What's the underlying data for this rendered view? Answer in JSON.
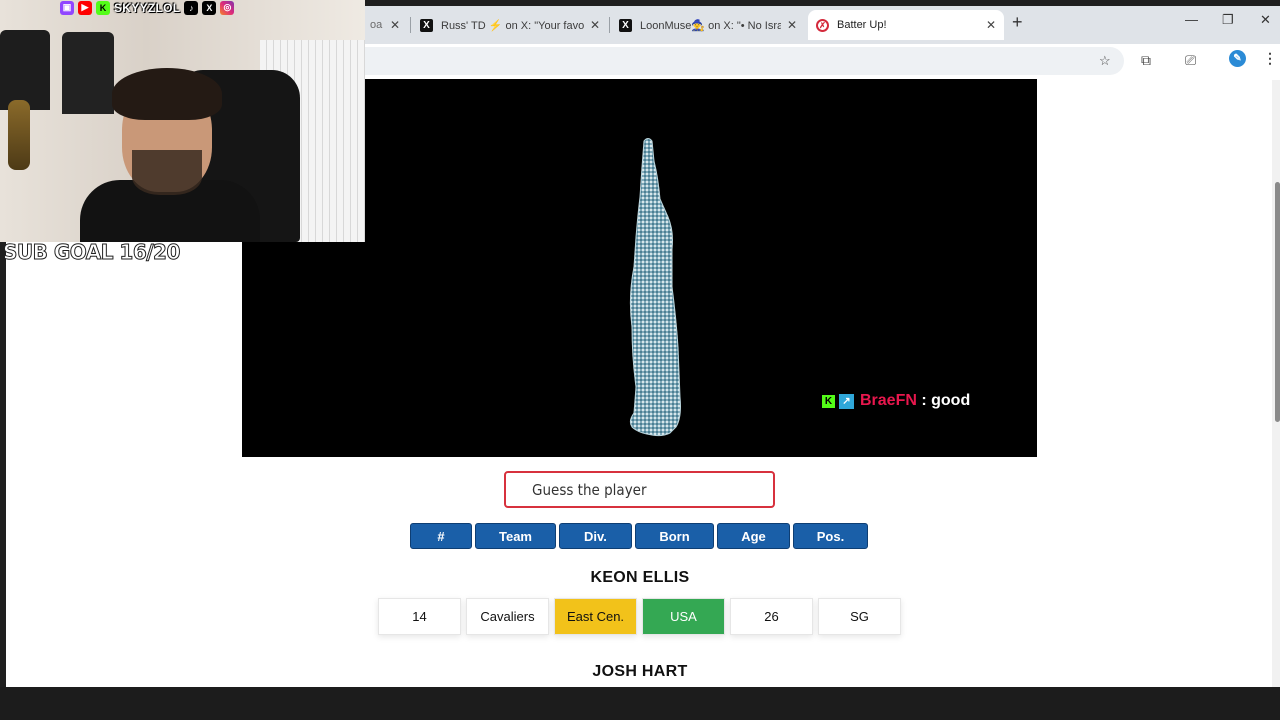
{
  "browser": {
    "tabs": [
      {
        "title": "oa",
        "favicon": "x-icon",
        "close": "✕"
      },
      {
        "title": "Russ' TD ⚡ on X: \"Your favorite",
        "favicon": "x-icon",
        "close": "✕"
      },
      {
        "title": "LoonMuse🧙 on X: \"• No Israel",
        "favicon": "x-icon",
        "close": "✕"
      },
      {
        "title": "Batter Up!",
        "favicon": "batter-up-icon",
        "close": "✕",
        "active": true
      }
    ],
    "new_tab": "+",
    "window_controls": {
      "minimize": "—",
      "restore": "❐",
      "close": "✕"
    },
    "toolbar": {
      "star": "☆",
      "extensions": "⧉",
      "cast": "⎚",
      "menu": "⋮"
    }
  },
  "stream_overlay": {
    "social_handle": "SKYYZLOL",
    "sub_goal": "SUB GOAL 16/20",
    "chat": {
      "user": "BraeFN",
      "separator": " : ",
      "message": "good"
    }
  },
  "game": {
    "guess_placeholder": "Guess the player",
    "columns": [
      "#",
      "Team",
      "Div.",
      "Born",
      "Age",
      "Pos."
    ],
    "guesses": [
      {
        "name": "KEON ELLIS",
        "cells": [
          "14",
          "Cavaliers",
          "East Cen.",
          "USA",
          "26",
          "SG"
        ],
        "colors": [
          "none",
          "none",
          "yellow",
          "green",
          "none",
          "none"
        ]
      },
      {
        "name": "JOSH HART",
        "cells": [],
        "colors": []
      }
    ],
    "colors": {
      "header": "#1a5fa8",
      "partial": "#f2c21a",
      "correct": "#34a853",
      "input_border": "#d7313d"
    }
  }
}
